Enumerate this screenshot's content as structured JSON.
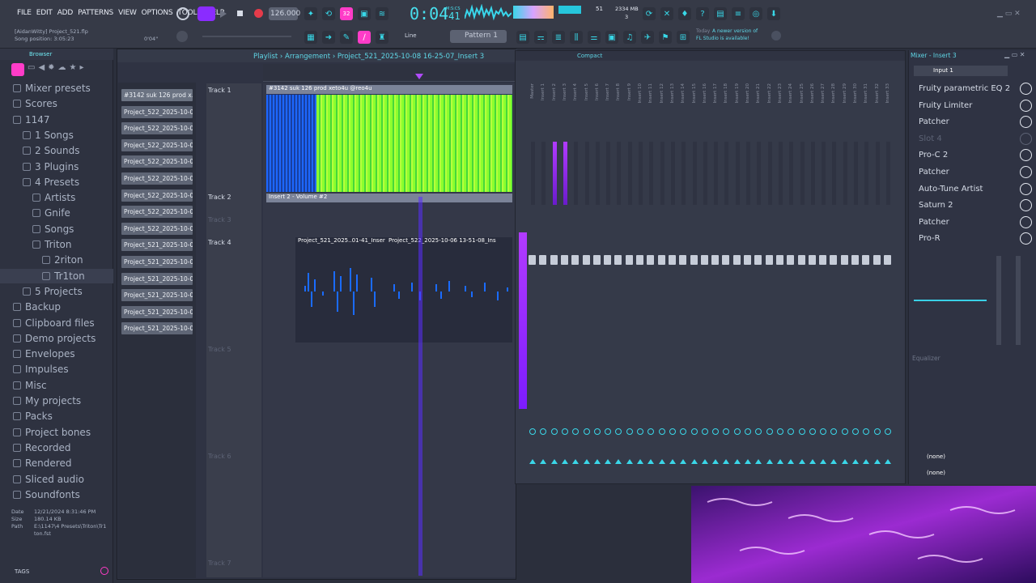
{
  "menu": [
    "FILE",
    "EDIT",
    "ADD",
    "PATTERNS",
    "VIEW",
    "OPTIONS",
    "TOOLS",
    "HELP"
  ],
  "transport": {
    "tempo": "126.000",
    "time": "0:04",
    "time_sub": "41",
    "time_label": "M:S:CS",
    "cpu": "51",
    "ram": "2334 MB",
    "ram_sub": "3",
    "hint_label": "Line",
    "pattern": "Pattern 1",
    "pattern_sub": "32"
  },
  "project": {
    "user": "[AidanWitty] Project_521.flp",
    "position_label": "Song position: 3:05:23",
    "cursor": "0'04\""
  },
  "news": {
    "day": "Today",
    "line1": "A newer version of",
    "line2": "FL Studio is available!"
  },
  "browser": {
    "title": "Browser",
    "items": [
      {
        "label": "Mixer presets",
        "indent": 0
      },
      {
        "label": "Scores",
        "indent": 0
      },
      {
        "label": "1147",
        "indent": 0
      },
      {
        "label": "1 Songs",
        "indent": 1
      },
      {
        "label": "2 Sounds",
        "indent": 1
      },
      {
        "label": "3 Plugins",
        "indent": 1
      },
      {
        "label": "4 Presets",
        "indent": 1
      },
      {
        "label": "Artists",
        "indent": 2
      },
      {
        "label": "Gnife",
        "indent": 2
      },
      {
        "label": "Songs",
        "indent": 2
      },
      {
        "label": "Triton",
        "indent": 2
      },
      {
        "label": "2riton",
        "indent": 3
      },
      {
        "label": "Tr1ton",
        "indent": 3
      },
      {
        "label": "5 Projects",
        "indent": 1
      },
      {
        "label": "Backup",
        "indent": 0
      },
      {
        "label": "Clipboard files",
        "indent": 0
      },
      {
        "label": "Demo projects",
        "indent": 0
      },
      {
        "label": "Envelopes",
        "indent": 0
      },
      {
        "label": "Impulses",
        "indent": 0
      },
      {
        "label": "Misc",
        "indent": 0
      },
      {
        "label": "My projects",
        "indent": 0
      },
      {
        "label": "Packs",
        "indent": 0
      },
      {
        "label": "Project bones",
        "indent": 0
      },
      {
        "label": "Recorded",
        "indent": 0
      },
      {
        "label": "Rendered",
        "indent": 0
      },
      {
        "label": "Sliced audio",
        "indent": 0
      },
      {
        "label": "Soundfonts",
        "indent": 0
      }
    ],
    "file_date_k": "Date",
    "file_date": "12/21/2024 8:31:46 PM",
    "file_size_k": "Size",
    "file_size": "180.14 KB",
    "file_path_k": "Path",
    "file_path": "E:\\1147\\4 Presets\\Triton\\Tr1ton.fst",
    "tags": "TAGS"
  },
  "picker": [
    "#3142 suk 126 prod x...",
    "Project_522_2025-10-06...",
    "Project_522_2025-10-06...",
    "Project_522_2025-10-06...",
    "Project_522_2025-10-06...",
    "Project_522_2025-10-06...",
    "Project_522_2025-10-06...",
    "Project_522_2025-10-06...",
    "Project_522_2025-10-06...",
    "Project_521_2025-10-08...",
    "Project_521_2025-10-08...",
    "Project_521_2025-10-08...",
    "Project_521_2025-10-08...",
    "Project_521_2025-10-08...",
    "Project_521_2025-10-08..."
  ],
  "playlist": {
    "title": "Playlist › Arrangement › Project_521_2025-10-08 16-25-07_Insert 3",
    "tracks": [
      "Track 1",
      "Track 2",
      "Track 3",
      "Track 4",
      "Track 5",
      "Track 6",
      "Track 7"
    ],
    "clip1": "#3142 suk 126 prod xeto4u @reo4u",
    "clip2": "Insert 2 - Volume #2",
    "clip3": "Project_521_2025..01-41_Inser",
    "clip4": "Project_522_2025-10-06 13-51-08_Ins"
  },
  "mixer": {
    "title": "Compact",
    "channels": [
      "Master",
      "Insert 1",
      "Insert 2",
      "Insert 3",
      "Insert 4",
      "Insert 5",
      "Insert 6",
      "Insert 7",
      "Insert 8",
      "Insert 9",
      "Insert 10",
      "Insert 11",
      "Insert 12",
      "Insert 13",
      "Insert 14",
      "Insert 15",
      "Insert 16",
      "Insert 17",
      "Insert 18",
      "Insert 19",
      "Insert 20",
      "Insert 21",
      "Insert 22",
      "Insert 23",
      "Insert 24",
      "Insert 25",
      "Insert 26",
      "Insert 27",
      "Insert 28",
      "Insert 29",
      "Insert 30",
      "Insert 31",
      "Insert 32",
      "Insert 33"
    ]
  },
  "insert": {
    "title": "Mixer - Insert 3",
    "input": "Input 1",
    "slots": [
      "Fruity parametric EQ 2",
      "Fruity Limiter",
      "Patcher",
      "Slot 4",
      "Pro-C 2",
      "Patcher",
      "Auto-Tune Artist",
      "Saturn 2",
      "Patcher",
      "Pro-R"
    ],
    "eq_label": "Equalizer",
    "out1": "(none)",
    "out2": "(none)"
  },
  "colors": {
    "accent": "#3ad6e8",
    "pink": "#ff3cc8",
    "purple": "#9a2cff",
    "green": "#7cff3a"
  }
}
